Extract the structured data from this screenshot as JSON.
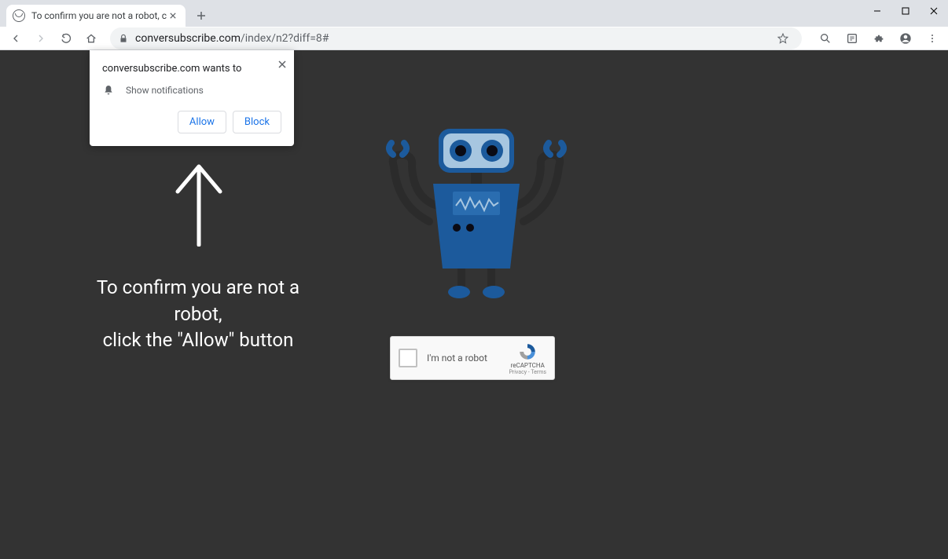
{
  "browser": {
    "tab_title": "To confirm you are not a robot, c",
    "url_domain": "conversubscribe.com",
    "url_path": "/index/n2?diff=8#"
  },
  "permission_popup": {
    "site_wants_to": "conversubscribe.com wants to",
    "request_text": "Show notifications",
    "allow_label": "Allow",
    "block_label": "Block"
  },
  "page": {
    "instruction_line1": "To confirm you are not a robot,",
    "instruction_line2": "click the \"Allow\" button"
  },
  "recaptcha": {
    "label": "I'm not a robot",
    "name": "reCAPTCHA",
    "links": "Privacy - Terms"
  }
}
